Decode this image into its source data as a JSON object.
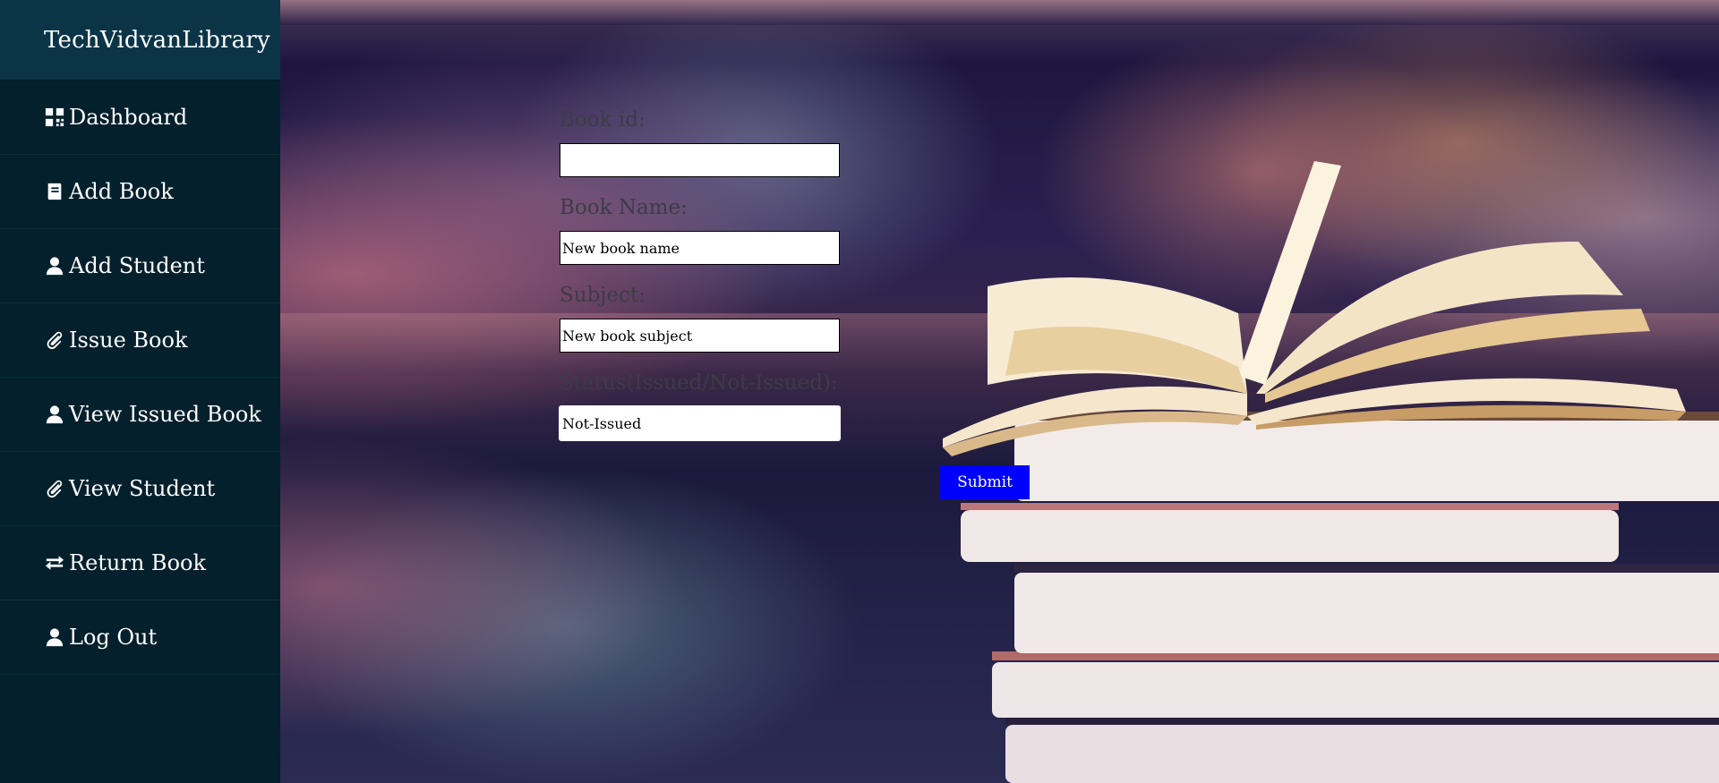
{
  "app": {
    "brand": "TechVidvanLibrary"
  },
  "sidebar": {
    "items": [
      {
        "label": "Dashboard",
        "icon": "dashboard-grid-icon"
      },
      {
        "label": "Add Book",
        "icon": "book-icon"
      },
      {
        "label": "Add Student",
        "icon": "user-icon"
      },
      {
        "label": "Issue Book",
        "icon": "paperclip-icon"
      },
      {
        "label": "View Issued Book",
        "icon": "user-icon"
      },
      {
        "label": "View Student",
        "icon": "paperclip-icon"
      },
      {
        "label": "Return Book",
        "icon": "exchange-arrows-icon"
      },
      {
        "label": "Log Out",
        "icon": "user-icon"
      }
    ]
  },
  "form": {
    "book_id_label": "Book id:",
    "book_id_value": "",
    "book_name_label": "Book Name:",
    "book_name_value": "New book name",
    "subject_label": "Subject:",
    "subject_value": "New book subject",
    "status_label": "Status(Issued/Not-Issued):",
    "status_value": "Not-Issued",
    "submit_label": "Submit"
  },
  "colors": {
    "sidebar_bg": "#03202c",
    "brand_bg": "#0b3547",
    "submit_bg": "#0000ff"
  }
}
